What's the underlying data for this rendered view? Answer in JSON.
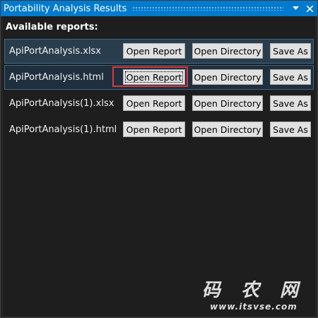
{
  "window": {
    "title": "Portability Analysis Results",
    "dropdown_icon": "chevron-down-icon",
    "close_icon": "close-icon"
  },
  "section": {
    "header": "Available reports:"
  },
  "reports": [
    {
      "filename": "ApiPortAnalysis.xlsx",
      "open_report_label": "Open Report",
      "open_directory_label": "Open Directory",
      "save_as_label": "Save As"
    },
    {
      "filename": "ApiPortAnalysis.html",
      "open_report_label": "Open Report",
      "open_directory_label": "Open Directory",
      "save_as_label": "Save As"
    },
    {
      "filename": "ApiPortAnalysis(1).xlsx",
      "open_report_label": "Open Report",
      "open_directory_label": "Open Directory",
      "save_as_label": "Save As"
    },
    {
      "filename": "ApiPortAnalysis(1).html",
      "open_report_label": "Open Report",
      "open_directory_label": "Open Directory",
      "save_as_label": "Save As"
    }
  ],
  "watermark": {
    "line1": "码 农 网",
    "line2": "www.itsvse.com"
  },
  "colors": {
    "titlebar": "#007acc",
    "background": "#1e1e1e",
    "selected_row": "#2a3d4d",
    "callout": "#e0353b"
  }
}
